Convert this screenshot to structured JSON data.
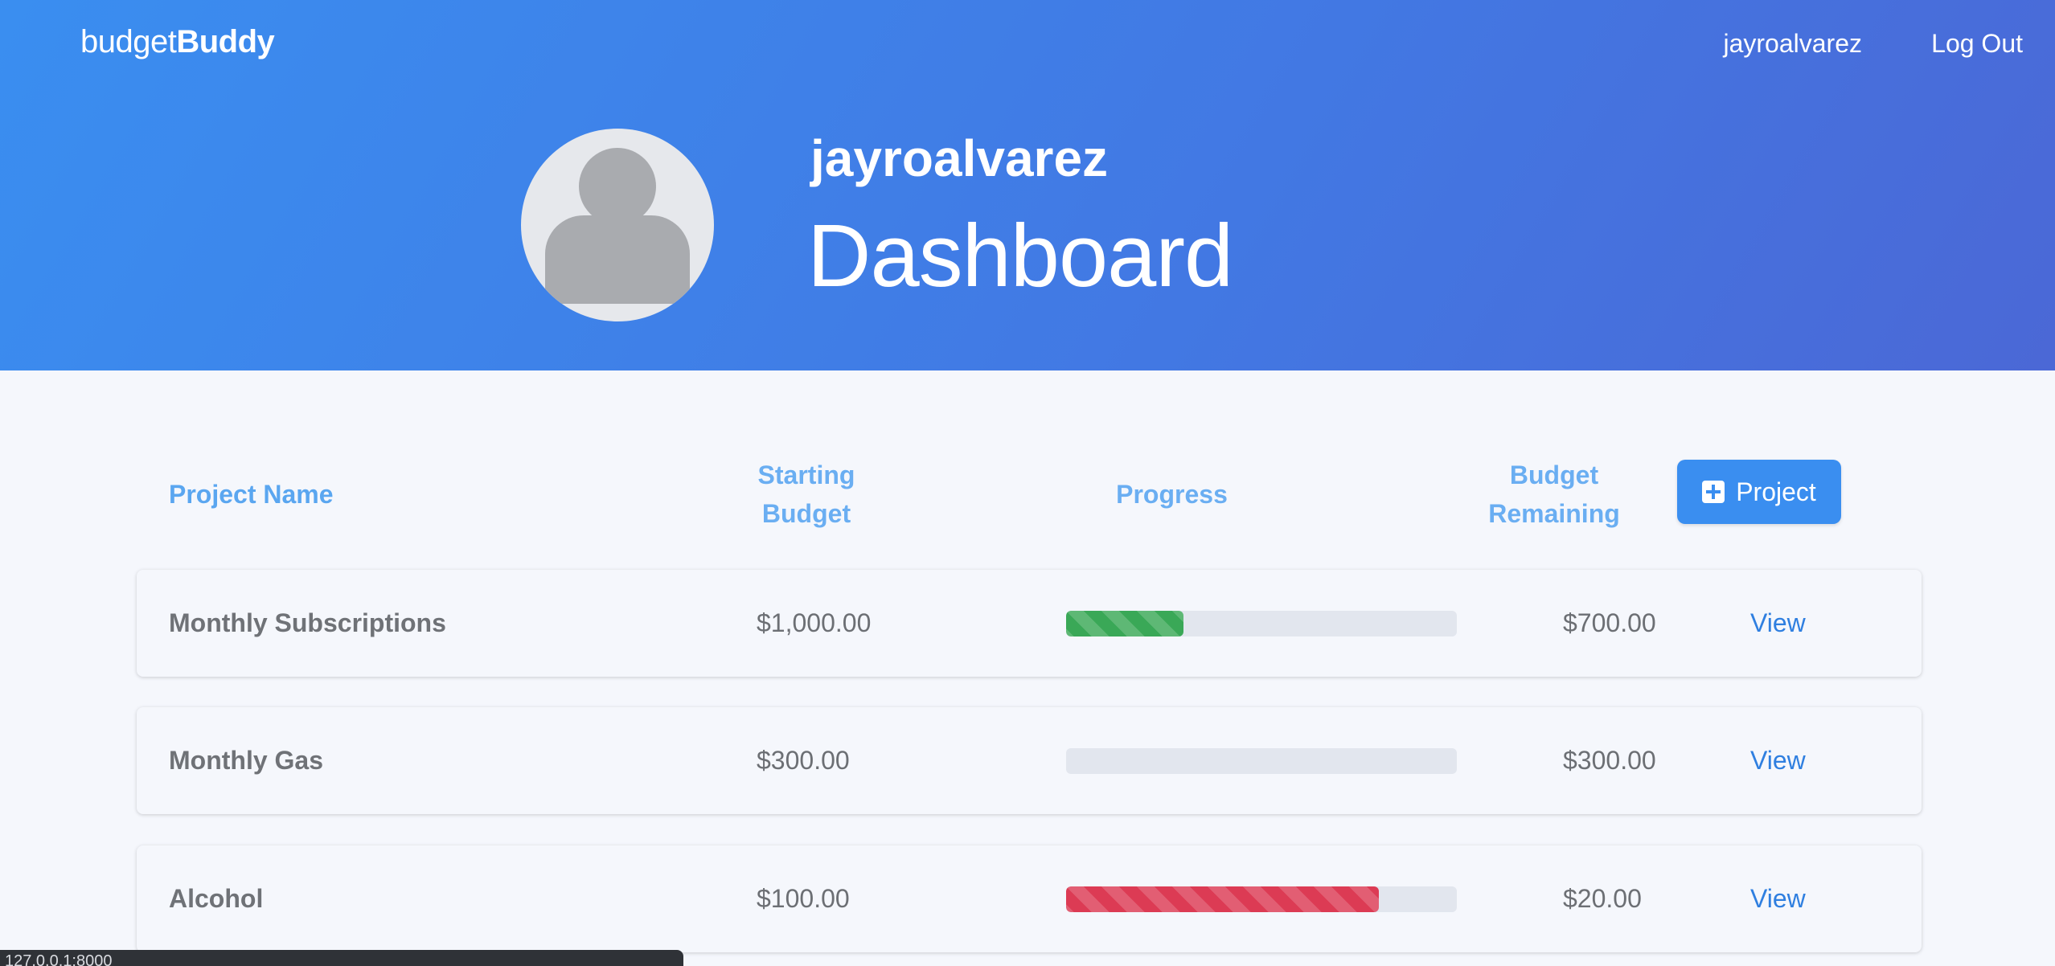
{
  "nav": {
    "brand_light": "budget",
    "brand_bold": "Buddy",
    "username": "jayroalvarez",
    "logout": "Log Out"
  },
  "hero": {
    "username": "jayroalvarez",
    "title": "Dashboard",
    "avatar_icon": "user-avatar-placeholder-icon"
  },
  "table": {
    "headers": {
      "name": "Project Name",
      "start_line1": "Starting",
      "start_line2": "Budget",
      "progress": "Progress",
      "remain_line1": "Budget",
      "remain_line2": "Remaining"
    },
    "add_button": "Project",
    "add_icon": "plus-square-icon",
    "rows": [
      {
        "name": "Monthly Subscriptions",
        "starting_budget": "$1,000.00",
        "progress_fraction": 0.3,
        "progress_status": "ok",
        "remaining": "$700.00",
        "action": "View"
      },
      {
        "name": "Monthly Gas",
        "starting_budget": "$300.00",
        "progress_fraction": 0.0,
        "progress_status": "ok",
        "remaining": "$300.00",
        "action": "View"
      },
      {
        "name": "Alcohol",
        "starting_budget": "$100.00",
        "progress_fraction": 0.8,
        "progress_status": "danger",
        "remaining": "$20.00",
        "action": "View"
      }
    ]
  },
  "status_bar": {
    "url": "127.0.0.1:8000"
  },
  "colors": {
    "primary": "#3a8ef0",
    "progress_ok": "#3aa857",
    "progress_danger": "#dc3b54",
    "link": "#2f7fe0"
  }
}
